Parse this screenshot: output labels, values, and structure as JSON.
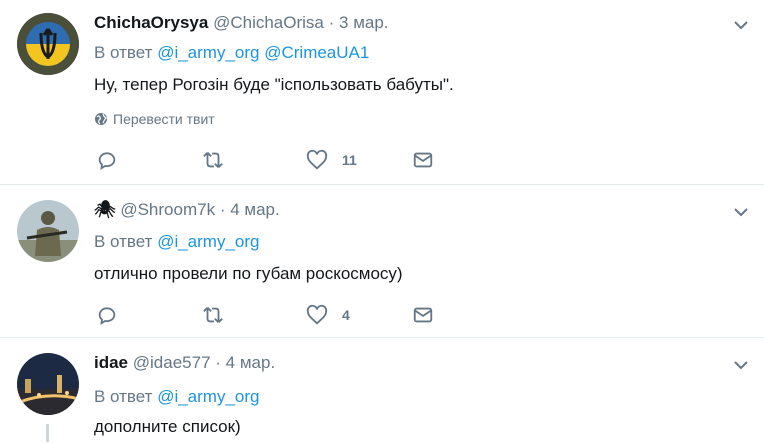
{
  "tweets": [
    {
      "name": "ChichaOrysya",
      "handle": "@ChichaOrisa",
      "dot": "·",
      "time": "3 мар.",
      "reply_prefix": "В ответ",
      "reply_users": [
        "@i_army_org",
        "@CrimeaUA1"
      ],
      "text": "Ну, тепер Рогозін буде \"ісполь­зовать бабуты\".",
      "translate": "Перевести твит",
      "likes": "11",
      "avatar_icon": "trident-emblem-icon"
    },
    {
      "name": "🕷",
      "handle": "@Shroom7k",
      "dot": "·",
      "time": "4 мар.",
      "reply_prefix": "В ответ",
      "reply_users": [
        "@i_army_org"
      ],
      "text": "отлично провели по губам роскосмосу)",
      "likes": "4",
      "avatar_icon": "soldier-photo-icon"
    },
    {
      "name": "idae",
      "handle": "@idae577",
      "dot": "·",
      "time": "4 мар.",
      "reply_prefix": "В ответ",
      "reply_users": [
        "@i_army_org"
      ],
      "text": "дополните список)",
      "avatar_icon": "city-night-photo-icon"
    }
  ],
  "colors": {
    "link": "#1b95e0",
    "secondary_text": "#657786",
    "separator": "#e6ecf0"
  }
}
